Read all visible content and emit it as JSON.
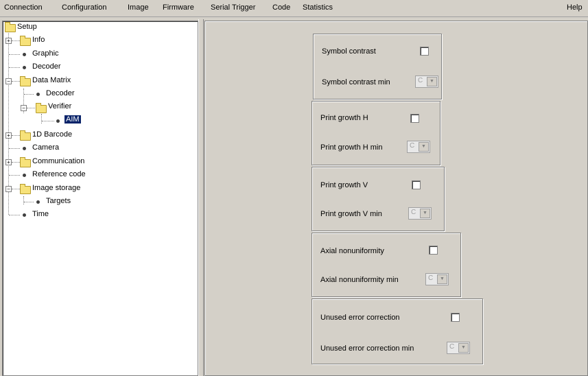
{
  "menu": [
    "Connection",
    "Configuration",
    "Image",
    "Firmware",
    "Serial Trigger",
    "Code",
    "Statistics"
  ],
  "help": "Help",
  "tree": {
    "setup": "Setup",
    "info": "Info",
    "graphic": "Graphic",
    "decoder": "Decoder",
    "data_matrix": "Data Matrix",
    "dm_decoder": "Decoder",
    "verifier": "Verifier",
    "aim": "AIM",
    "barcode_1d": "1D Barcode",
    "camera": "Camera",
    "communication": "Communication",
    "reference_code": "Reference code",
    "image_storage": "Image storage",
    "targets": "Targets",
    "time": "Time"
  },
  "groups": [
    {
      "label": "Symbol contrast",
      "min_label": "Symbol contrast min",
      "value": "C"
    },
    {
      "label": "Print growth H",
      "min_label": "Print growth H min",
      "value": "C"
    },
    {
      "label": "Print growth V",
      "min_label": "Print growth V min",
      "value": "C"
    },
    {
      "label": "Axial nonuniformity",
      "min_label": "Axial nonuniformity min",
      "value": "C"
    },
    {
      "label": "Unused error correction",
      "min_label": "Unused error correction min",
      "value": "C"
    }
  ],
  "colors": {
    "selection": "#0a246a",
    "folder": "#f7e27a",
    "background": "#d4d0c8"
  }
}
